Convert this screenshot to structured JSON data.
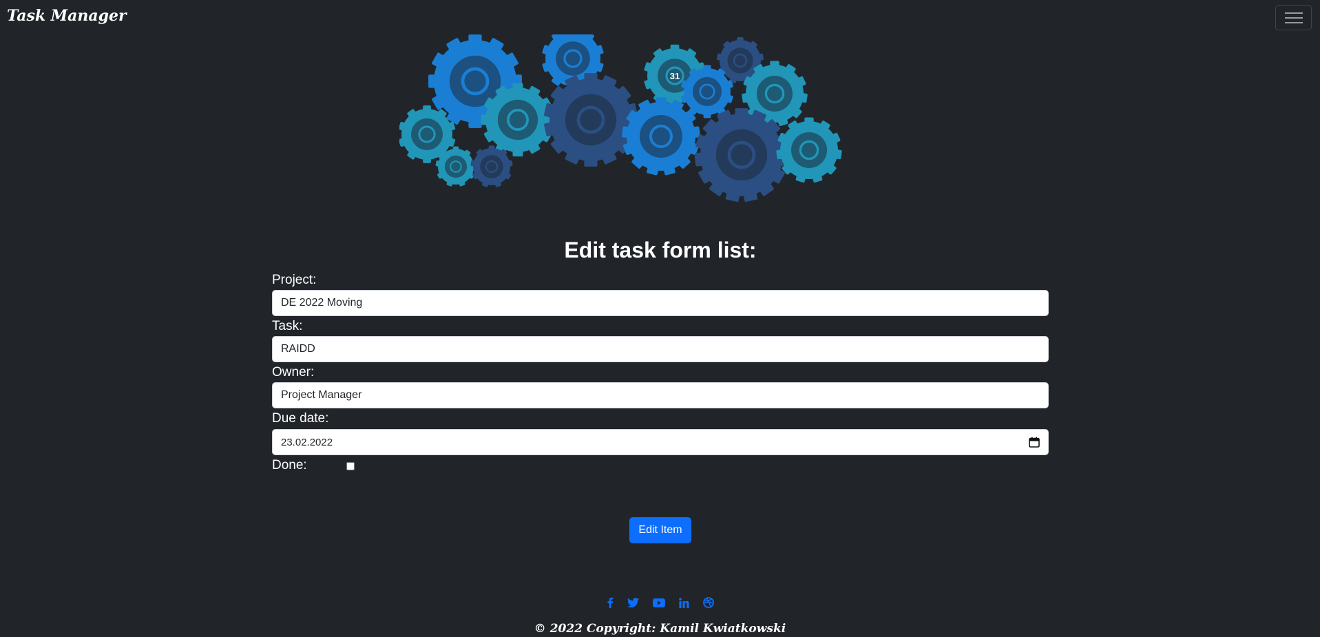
{
  "navbar": {
    "brand": "Task Manager",
    "toggler_icon": "hamburger-menu-icon"
  },
  "hero": {
    "icons": [
      "target-icon",
      "chart-board-icon",
      "calendar-icon",
      "bar-chart-icon",
      "pie-chart-icon",
      "store-icon",
      "lightbulb-icon",
      "briefcase-icon",
      "checklist-icon",
      "search-icon",
      "puzzle-icon",
      "credit-card-icon",
      "team-icon",
      "gold-bars-icon"
    ],
    "calendar_day": "31"
  },
  "form": {
    "title": "Edit task form list:",
    "project": {
      "label": "Project:",
      "value": "DE 2022 Moving"
    },
    "task": {
      "label": "Task:",
      "value": "RAIDD"
    },
    "owner": {
      "label": "Owner:",
      "value": "Project Manager"
    },
    "due_date": {
      "label": "Due date:",
      "value": "23.02.2022"
    },
    "done": {
      "label": "Done:",
      "checked": false
    },
    "submit_label": "Edit Item"
  },
  "footer": {
    "social_icons": [
      "facebook-icon",
      "twitter-icon",
      "youtube-icon",
      "linkedin-icon",
      "dribbble-icon"
    ],
    "copyright": "© 2022 Copyright: Kamil Kwiatkowski"
  },
  "colors": {
    "background": "#212529",
    "primary": "#0d6efd",
    "gear_blue": "#1a7fd4",
    "gear_teal": "#2196b8",
    "gear_navy": "#2b4f82"
  }
}
